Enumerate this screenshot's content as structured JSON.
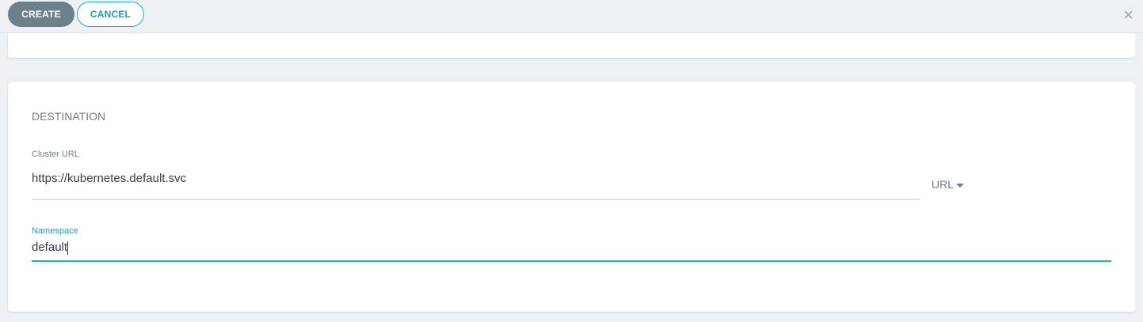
{
  "toolbar": {
    "create_label": "CREATE",
    "cancel_label": "CANCEL",
    "close_icon": "×"
  },
  "destination": {
    "title": "DESTINATION",
    "cluster_url": {
      "label": "Cluster URL",
      "value": "https://kubernetes.default.svc",
      "type_selector": "URL"
    },
    "namespace": {
      "label": "Namespace",
      "value": "default"
    }
  },
  "colors": {
    "accent": "#1ab3c8",
    "primary_button": "#6d7f8b"
  }
}
